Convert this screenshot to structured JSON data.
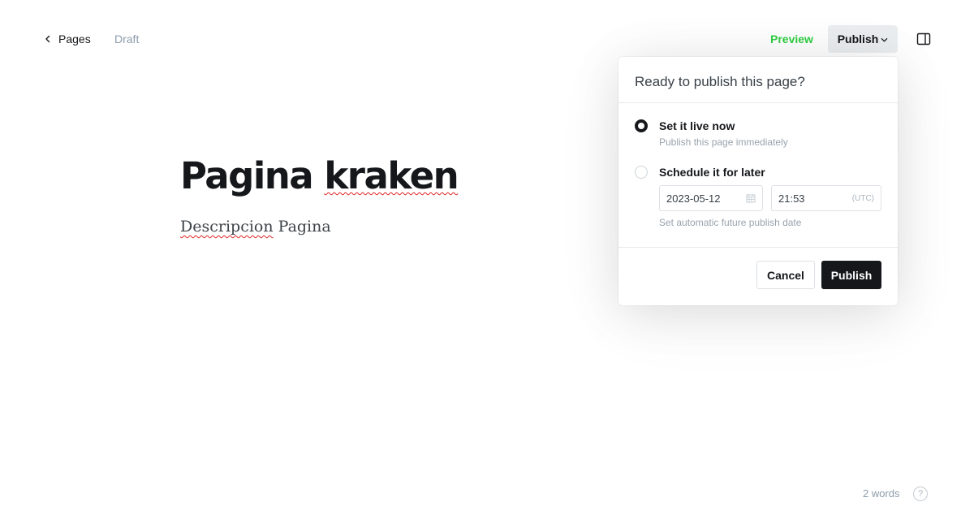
{
  "header": {
    "back_label": "Pages",
    "status": "Draft",
    "preview_label": "Preview",
    "publish_label": "Publish"
  },
  "editor": {
    "title_word1": "Pagina",
    "title_word2": "kraken",
    "body_word1": "Descripcion",
    "body_word2": "Pagina"
  },
  "publish_menu": {
    "heading": "Ready to publish this page?",
    "options": [
      {
        "label": "Set it live now",
        "description": "Publish this page immediately",
        "selected": true
      },
      {
        "label": "Schedule it for later",
        "selected": false
      }
    ],
    "date_value": "2023-05-12",
    "time_value": "21:53",
    "timezone": "(UTC)",
    "schedule_hint": "Set automatic future publish date",
    "cancel_label": "Cancel",
    "publish_label": "Publish"
  },
  "footer": {
    "word_count": "2 words",
    "help_label": "?"
  },
  "colors": {
    "preview_green": "#30cf43",
    "publish_dark": "#15171a",
    "muted": "#8e9cac"
  }
}
